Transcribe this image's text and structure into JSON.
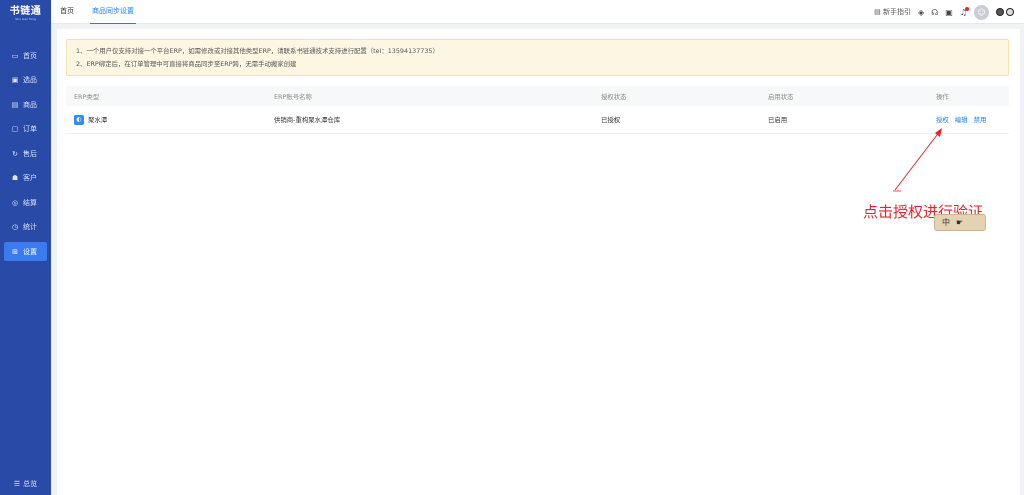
{
  "brand": {
    "name": "书链通",
    "sub": "Shu Lian Tong"
  },
  "sidebar": {
    "items": [
      {
        "label": "首页",
        "icon": "monitor-icon",
        "glyph": "▭"
      },
      {
        "label": "选品",
        "icon": "picture-icon",
        "glyph": "▣"
      },
      {
        "label": "商品",
        "icon": "goods-icon",
        "glyph": "▤"
      },
      {
        "label": "订单",
        "icon": "order-icon",
        "glyph": "▢"
      },
      {
        "label": "售后",
        "icon": "refresh-icon",
        "glyph": "↻"
      },
      {
        "label": "客户",
        "icon": "customer-icon",
        "glyph": "☗"
      },
      {
        "label": "结算",
        "icon": "settle-icon",
        "glyph": "◎"
      },
      {
        "label": "统计",
        "icon": "clock-icon",
        "glyph": "◷"
      },
      {
        "label": "设置",
        "icon": "settings-icon",
        "glyph": "⊞"
      }
    ],
    "footer": {
      "label": "总览",
      "glyph": "☰"
    }
  },
  "header": {
    "tabs": [
      "首页",
      "商品同步设置"
    ],
    "guide": "新手指引",
    "guide_glyph": "▤",
    "avatar_glyph": "☺"
  },
  "notice": {
    "lines": [
      "1、一个用户仅支持对接一个平台ERP，如需修改或对接其他类型ERP，请联系书链通技术支持进行配置（tel：13594137735）",
      "2、ERP绑定后，在订单管理中可直接将商品同步至ERP跨，无需手动搬家创建"
    ]
  },
  "table": {
    "headers": [
      "ERP类型",
      "ERP账号名称",
      "授权状态",
      "启用状态",
      "操作"
    ],
    "rows": [
      {
        "erp_type": "聚水潭",
        "account": "供销商-重构聚水潭仓库",
        "auth_status": "已授权",
        "enable_status": "已启用",
        "actions": [
          "授权",
          "编辑",
          "禁用"
        ]
      }
    ]
  },
  "annotation": {
    "text": "点击授权进行验证",
    "color": "#e8222a"
  },
  "ime": {
    "label": "中",
    "glyph": "☛"
  },
  "colors": {
    "sidebar": "#2a4aa8",
    "accent": "#1e7ff0",
    "notice_bg": "#fdf6e3"
  }
}
